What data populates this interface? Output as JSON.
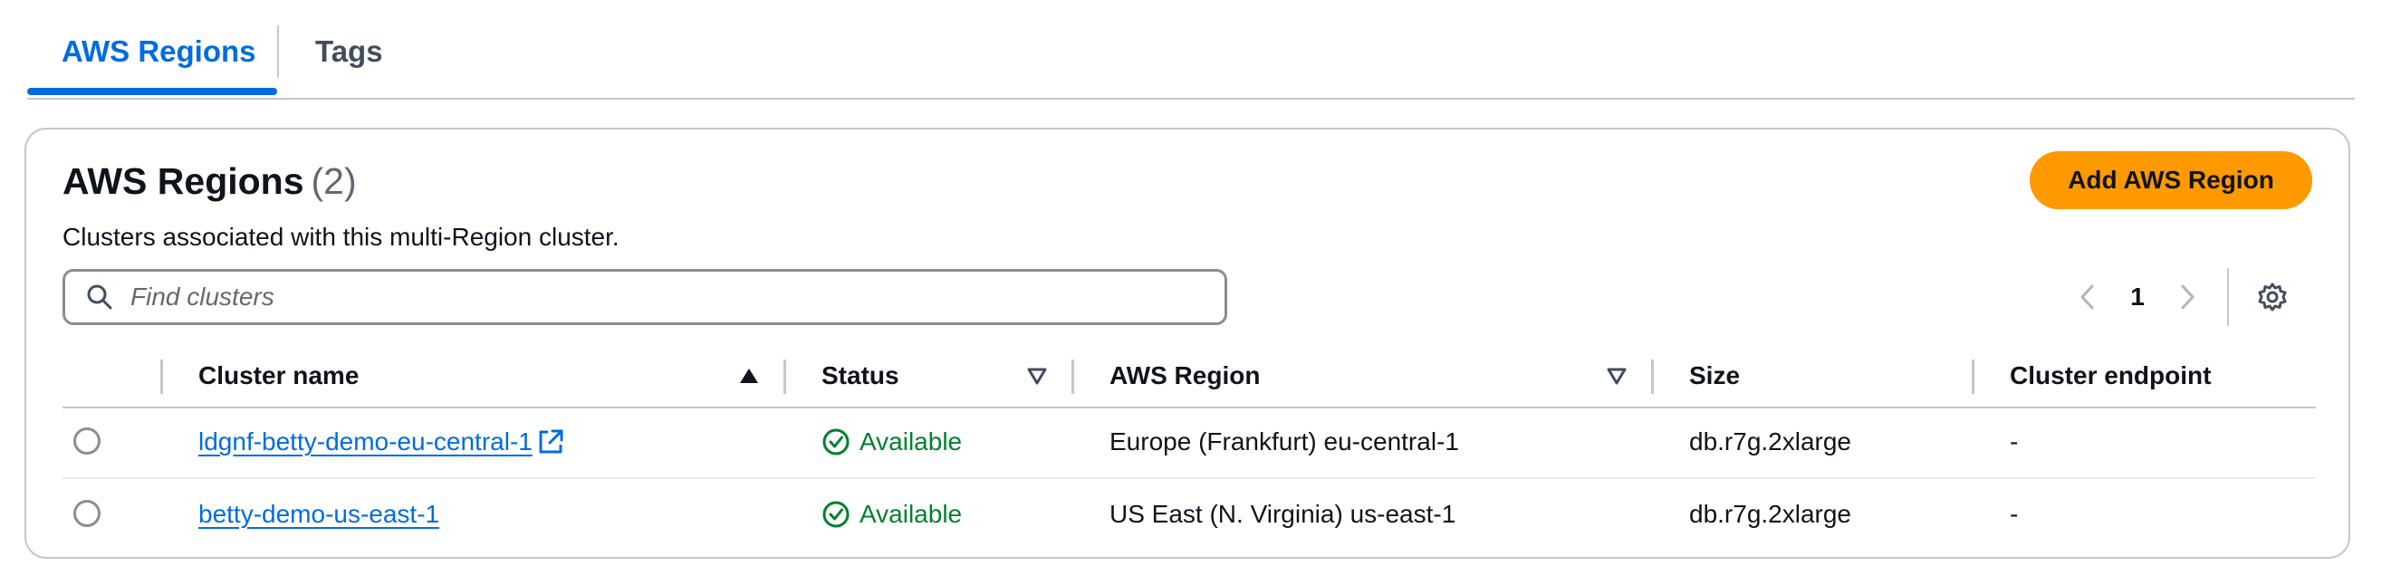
{
  "tabs": [
    {
      "label": "AWS Regions",
      "active": true
    },
    {
      "label": "Tags",
      "active": false
    }
  ],
  "header": {
    "title": "AWS Regions",
    "count": "(2)",
    "description": "Clusters associated with this multi-Region cluster.",
    "add_button": "Add AWS Region"
  },
  "search": {
    "placeholder": "Find clusters",
    "value": ""
  },
  "pagination": {
    "current_page": "1"
  },
  "table": {
    "columns": [
      "Cluster name",
      "Status",
      "AWS Region",
      "Size",
      "Cluster endpoint"
    ],
    "rows": [
      {
        "name": "ldgnf-betty-demo-eu-central-1",
        "external_link": true,
        "status": "Available",
        "region": "Europe (Frankfurt) eu-central-1",
        "size": "db.r7g.2xlarge",
        "endpoint": "-"
      },
      {
        "name": "betty-demo-us-east-1",
        "external_link": false,
        "status": "Available",
        "region": "US East (N. Virginia) us-east-1",
        "size": "db.r7g.2xlarge",
        "endpoint": "-"
      }
    ]
  },
  "colors": {
    "accent": "#006ce0",
    "primary_button": "#ff9900",
    "success": "#00802f",
    "border": "#c6c6cd"
  }
}
